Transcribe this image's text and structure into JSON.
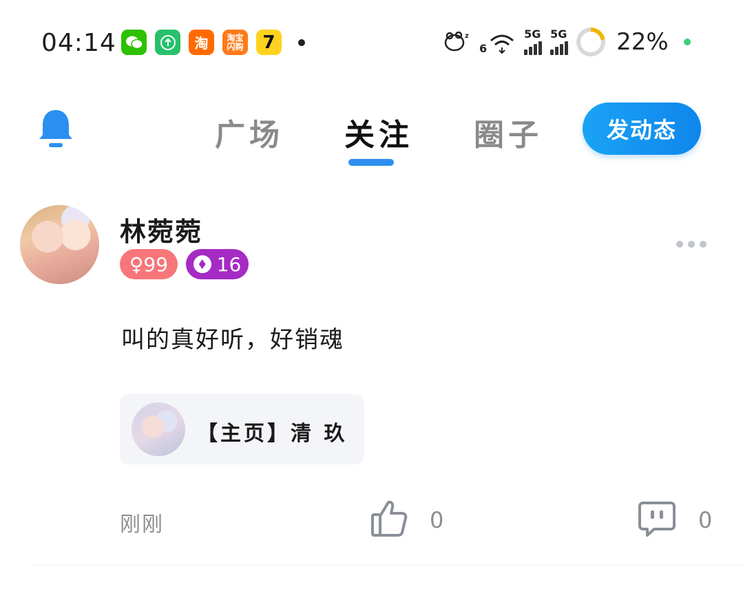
{
  "status_bar": {
    "time": "04:14",
    "notification_icons": [
      {
        "name": "wechat-icon",
        "color": "#2dc100",
        "glyph": "💬"
      },
      {
        "name": "upload-icon",
        "color": "#27c16b",
        "glyph": "⇧"
      },
      {
        "name": "taobao-icon",
        "color": "#ff6a00",
        "glyph": "淘"
      },
      {
        "name": "taobao-flash-icon",
        "color": "#ff7a1a",
        "glyph": "闪"
      },
      {
        "name": "cat-app-icon",
        "color": "#ffd21f",
        "glyph": "7"
      }
    ],
    "network_1": "5G",
    "network_2": "5G",
    "wifi_sub": "6",
    "battery_percent": "22%",
    "battery_level": 0.22
  },
  "header": {
    "tabs": [
      {
        "label": "广场",
        "active": false
      },
      {
        "label": "关注",
        "active": true
      },
      {
        "label": "圈子",
        "active": false
      }
    ],
    "post_button_label": "发动态",
    "accent_color": "#2f8ef0"
  },
  "post": {
    "username": "林菀菀",
    "gender_badge": "♀99",
    "level_badge": "16",
    "content": "叫的真好听，好销魂",
    "link_card": {
      "title": "【主页】清 玖"
    },
    "timestamp": "刚刚",
    "like_count": "0",
    "comment_count": "0"
  }
}
